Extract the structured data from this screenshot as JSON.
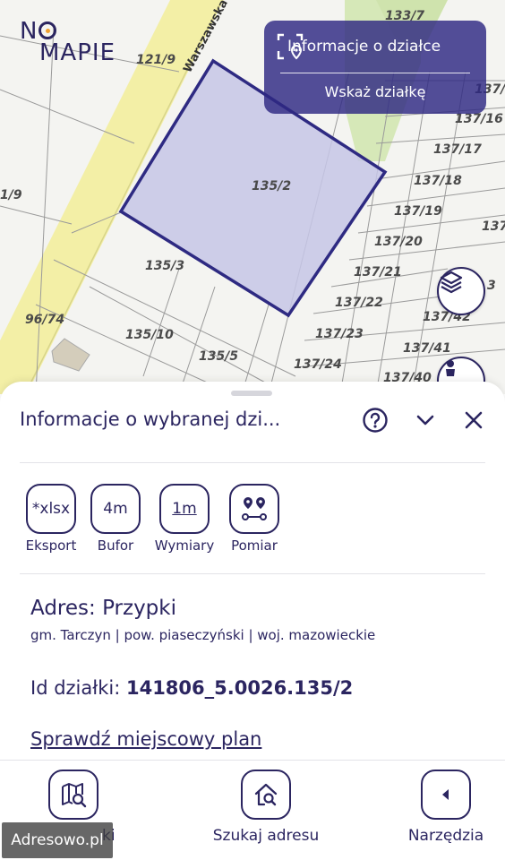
{
  "logo": {
    "line1_a": "N",
    "line2": "MAPIE"
  },
  "map": {
    "street": "Warszawska",
    "plot_labels": [
      "133/7",
      "121/9",
      "137/",
      "137/16",
      "137/17",
      "137/18",
      "137/19",
      "137",
      "137/20",
      "137/21",
      "3",
      "137/22",
      "137/42",
      "1/9",
      "135/2",
      "135/3",
      "96/74",
      "135/10",
      "135/5",
      "137/23",
      "137/24",
      "137/41",
      "137/40"
    ],
    "selected_plot": "135/2",
    "selection_color": "#2e2a82",
    "selection_fill": "#c5c5e6"
  },
  "info_box": {
    "title": "Informacje o działce",
    "action": "Wskaż działkę"
  },
  "map_buttons": {
    "layers_icon": "layers-icon",
    "person_icon": "person-icon"
  },
  "sheet": {
    "title": "Informacje o wybranej dzi...",
    "tools": [
      {
        "icon": "*xlsx",
        "label": "Eksport"
      },
      {
        "icon": "4m",
        "label": "Bufor"
      },
      {
        "icon": "1m",
        "label": "Wymiary"
      },
      {
        "icon": "measure-icon",
        "label": "Pomiar"
      }
    ],
    "address_prefix": "Adres: ",
    "address": "Przypki",
    "admin": "gm. Tarczyn | pow. piaseczyński | woj. mazowieckie",
    "id_label": "Id działki: ",
    "id_value": "141806_5.0026.135/2",
    "plan_link": "Sprawdź miejscowy plan"
  },
  "bottom_nav": [
    {
      "label": "ki",
      "icon": "map-search-icon"
    },
    {
      "label": "Szukaj adresu",
      "icon": "home-search-icon"
    },
    {
      "label": "Narzędzia",
      "icon": "arrow-left-icon"
    }
  ],
  "watermark": "Adresowo.pl",
  "colors": {
    "primary": "#2b2560",
    "accent": "#f0a030"
  }
}
